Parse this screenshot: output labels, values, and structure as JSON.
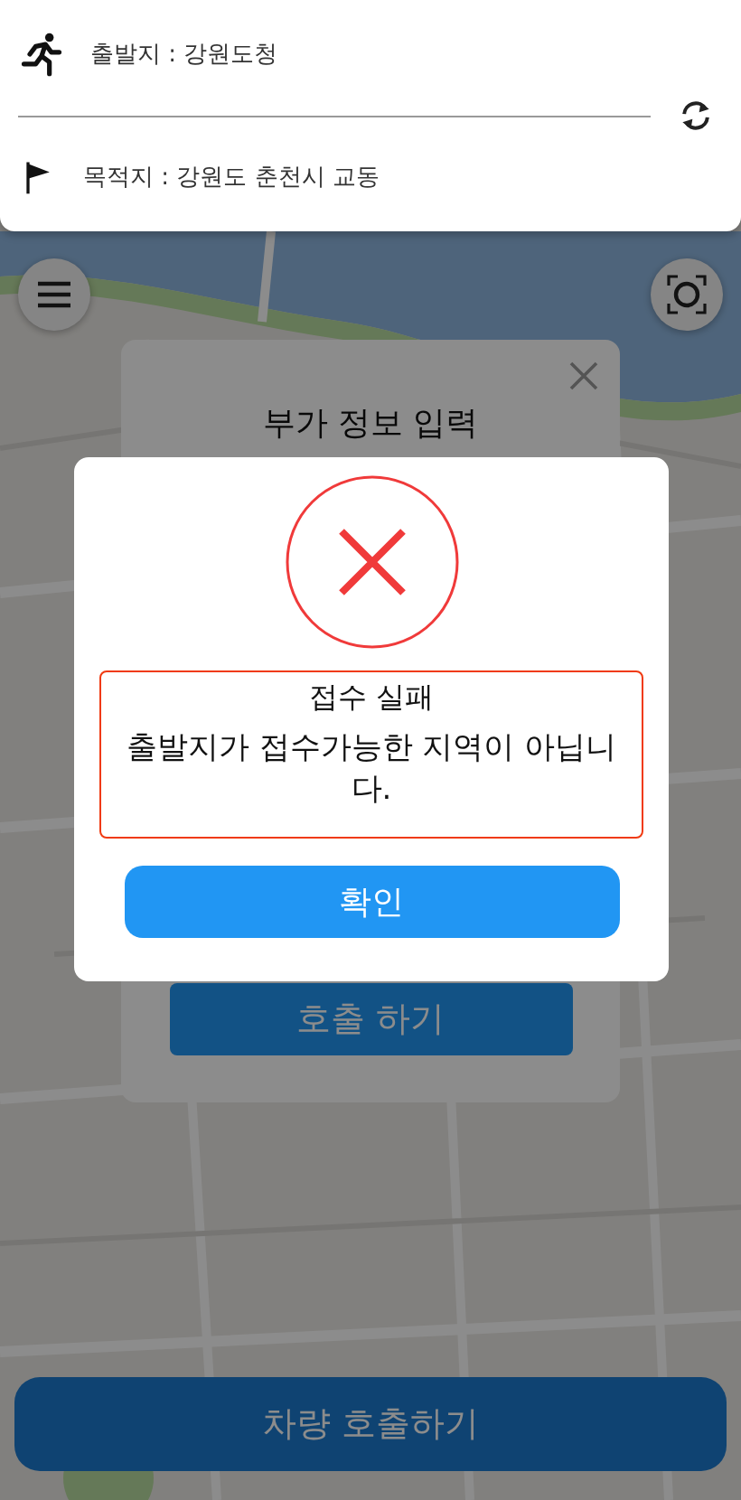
{
  "route": {
    "origin": "출발지 : 강원도청",
    "destination": "목적지 : 강원도 춘천시 교동"
  },
  "info_dialog": {
    "title": "부가 정보 입력",
    "submit_button": "호출 하기"
  },
  "alert": {
    "kind": "error",
    "title": "접수 실패",
    "message": "출발지가 접수가능한 지역이 아닙니다.",
    "confirm_button": "확인"
  },
  "call_button": "차량 호출하기"
}
